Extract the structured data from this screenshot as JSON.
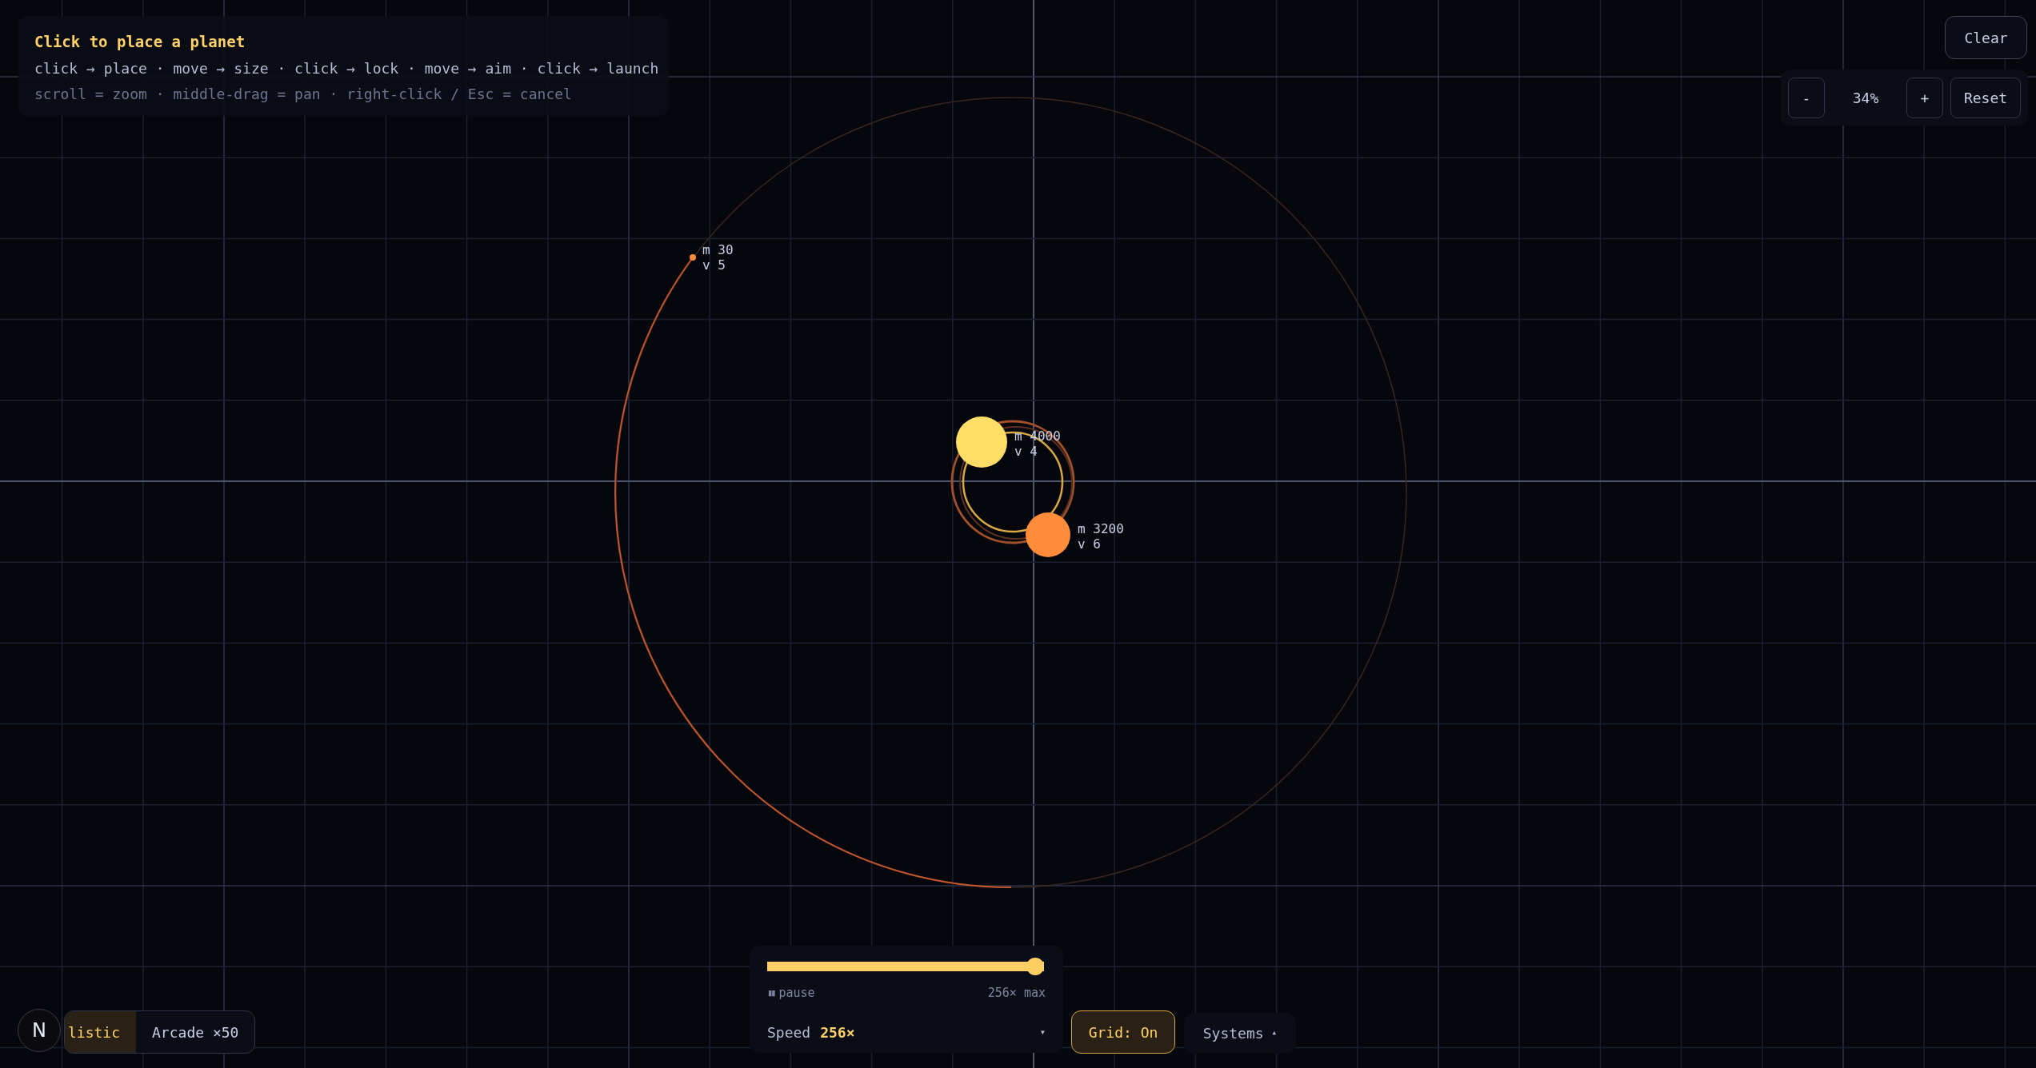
{
  "instructions": {
    "title": "Click to place a planet",
    "lines": [
      "click → place · move → size · click → lock · move → aim · click → launch",
      "scroll = zoom · middle-drag = pan · right-click / Esc = cancel"
    ]
  },
  "clear_button": "Clear",
  "zoom": {
    "minus": "-",
    "level": "34%",
    "plus": "+",
    "reset": "Reset"
  },
  "bodies": [
    {
      "kind": "star",
      "color": "#ffdd66",
      "mass": "m 4000",
      "velocity": "v 4"
    },
    {
      "kind": "star",
      "color": "#ff8c3a",
      "mass": "m 3200",
      "velocity": "v 6"
    },
    {
      "kind": "planet",
      "color": "#ff8c3a",
      "mass": "m 30",
      "velocity": "v 5"
    }
  ],
  "mode_toggle": [
    {
      "label": "listic",
      "selected": true
    },
    {
      "label": "Arcade ×50",
      "selected": false
    }
  ],
  "dev_badge": "N",
  "speed": {
    "level": 1,
    "pause_icon": "▮▮",
    "pause": "pause",
    "max": "256× max",
    "label": "Speed",
    "value": "256×",
    "caret": "▾"
  },
  "grid_button": {
    "label": "Grid: On",
    "on": true
  },
  "systems": {
    "label": "Systems",
    "caret": "▴"
  }
}
